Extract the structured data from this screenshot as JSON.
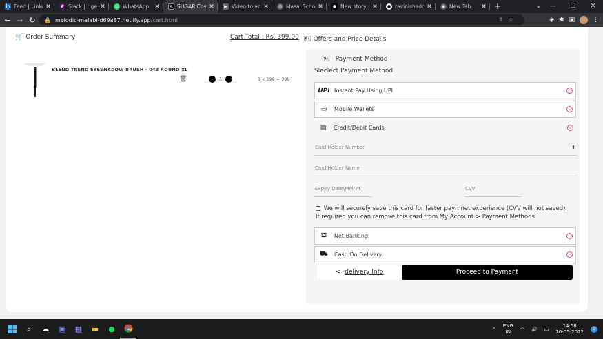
{
  "browser": {
    "tabs": [
      {
        "title": "Feed | LinkedIn",
        "favicon": "in",
        "color": "#0a66c2"
      },
      {
        "title": "Slack | ! general",
        "favicon": "S",
        "color": "#4a154b"
      },
      {
        "title": "WhatsApp",
        "favicon": "W",
        "color": "#25d366"
      },
      {
        "title": "SUGAR Cosmetics",
        "favicon": "S",
        "color": "#000000",
        "active": true
      },
      {
        "title": "Video to animated",
        "favicon": "V",
        "color": "#5f6368"
      },
      {
        "title": "Masai School",
        "favicon": "M",
        "color": "#5f6368"
      },
      {
        "title": "New story – Medium",
        "favicon": "M",
        "color": "#000000"
      },
      {
        "title": "ravinishadcode",
        "favicon": "G",
        "color": "#24292e"
      },
      {
        "title": "New Tab",
        "favicon": "N",
        "color": "#5f6368"
      }
    ],
    "new_tab": "+",
    "url_host": "melodic-malabi-d69a87.netlify.app",
    "url_path": "/cart.html"
  },
  "cart": {
    "order_summary": "Order Summary",
    "cart_total": "Cart Total : Rs. 399.00",
    "product_name": "BLEND TREND EYESHADOW BRUSH - 043 ROUND XL",
    "quantity": "1",
    "minus": "-",
    "plus": "+",
    "line_total": "1 x 399 = 399"
  },
  "payment": {
    "offers_title": "Offers and Price Details",
    "method_title": "Payment Method",
    "select_label": "Sleclect Payment Method",
    "options": {
      "upi": "Instant Pay Using UPI",
      "wallets": "Mobile Wallets",
      "cards": "Credit/Debit Cards",
      "netbanking": "Net Banking",
      "cod": "Cash On Delivery"
    },
    "fields": {
      "card_number": "Card Holder Number",
      "card_name": "Card Holder Name",
      "expiry": "Expiry Date(MM/YY)",
      "cvv": "CVV"
    },
    "save_note": "We will securely save this card for faster paymnet experience (CVV will not saved). If required you can remove this card from My Account > Payment Methods",
    "back_arrow": "<",
    "back_label": "delivery Info",
    "proceed": "Proceed to Payment"
  },
  "taskbar": {
    "lang_top": "ENG",
    "lang_bottom": "IN",
    "time": "14:58",
    "date": "10-05-2022",
    "notifications": "1"
  }
}
